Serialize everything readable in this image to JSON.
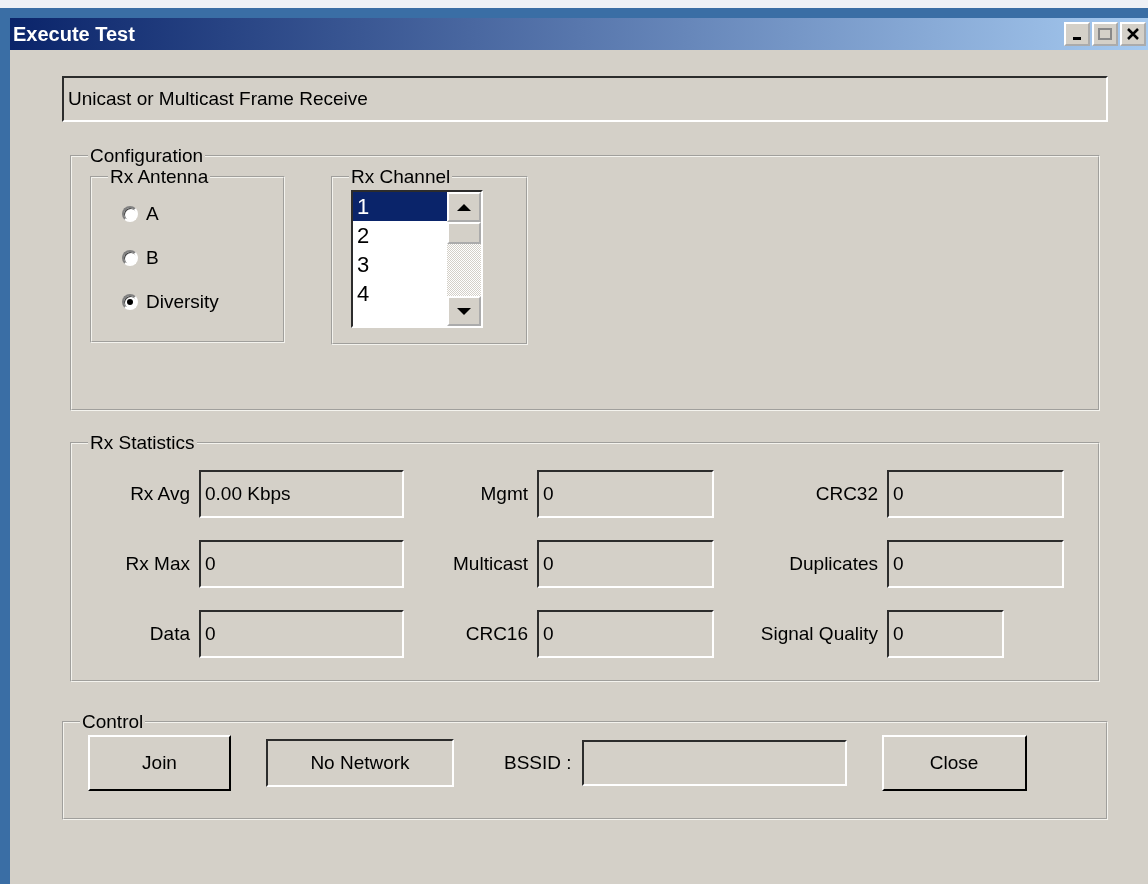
{
  "window": {
    "title": "Execute Test"
  },
  "description": "Unicast or Multicast Frame Receive",
  "configuration": {
    "title": "Configuration",
    "rx_antenna": {
      "title": "Rx Antenna",
      "options": [
        {
          "label": "A",
          "selected": false
        },
        {
          "label": "B",
          "selected": false
        },
        {
          "label": "Diversity",
          "selected": true
        }
      ]
    },
    "rx_channel": {
      "title": "Rx Channel",
      "items": [
        {
          "label": "1",
          "selected": true
        },
        {
          "label": "2",
          "selected": false
        },
        {
          "label": "3",
          "selected": false
        },
        {
          "label": "4",
          "selected": false
        }
      ]
    }
  },
  "rx_statistics": {
    "title": "Rx Statistics",
    "fields": [
      {
        "label": "Rx Avg",
        "value": "0.00 Kbps"
      },
      {
        "label": "Mgmt",
        "value": "0"
      },
      {
        "label": "CRC32",
        "value": "0"
      },
      {
        "label": "Rx Max",
        "value": "0"
      },
      {
        "label": "Multicast",
        "value": "0"
      },
      {
        "label": "Duplicates",
        "value": "0"
      },
      {
        "label": "Data",
        "value": "0"
      },
      {
        "label": "CRC16",
        "value": "0"
      },
      {
        "label": "Signal Quality",
        "value": "0"
      }
    ]
  },
  "control": {
    "title": "Control",
    "join_button": "Join",
    "status": "No Network",
    "bssid_label": "BSSID :",
    "close_button": "Close"
  }
}
